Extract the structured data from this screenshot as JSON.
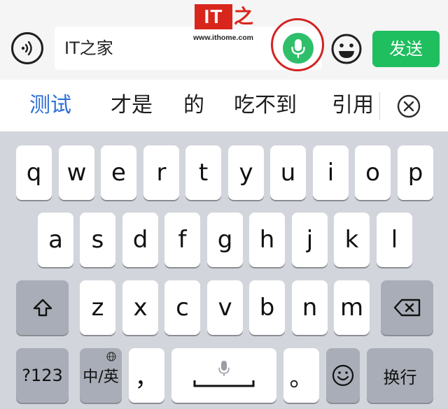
{
  "input_bar": {
    "text_value": "IT之家",
    "watermark": {
      "logo": "IT",
      "char": "之",
      "url": "www.ithome.com"
    },
    "send_label": "发送"
  },
  "candidates": {
    "items": [
      "测试",
      "才是",
      "的",
      "吃不到",
      "引用"
    ]
  },
  "keyboard": {
    "row1": [
      "q",
      "w",
      "e",
      "r",
      "t",
      "y",
      "u",
      "i",
      "o",
      "p"
    ],
    "row2": [
      "a",
      "s",
      "d",
      "f",
      "g",
      "h",
      "j",
      "k",
      "l"
    ],
    "row3": [
      "z",
      "x",
      "c",
      "v",
      "b",
      "n",
      "m"
    ],
    "numbers_label": "?123",
    "lang_label": "中/英",
    "comma_label": "，",
    "period_label": "。",
    "return_label": "换行"
  },
  "colors": {
    "accent_green": "#1fbe5e",
    "mic_green": "#2fbf6b",
    "highlight_red": "#d42323",
    "candidate_active_blue": "#2d6fd6",
    "keyboard_bg": "#d2d5dc"
  },
  "icons": [
    "voice-mode-icon",
    "microphone-icon",
    "emoji-icon",
    "close-circle-icon",
    "shift-icon",
    "backspace-icon",
    "globe-icon",
    "dictation-mic-icon"
  ]
}
